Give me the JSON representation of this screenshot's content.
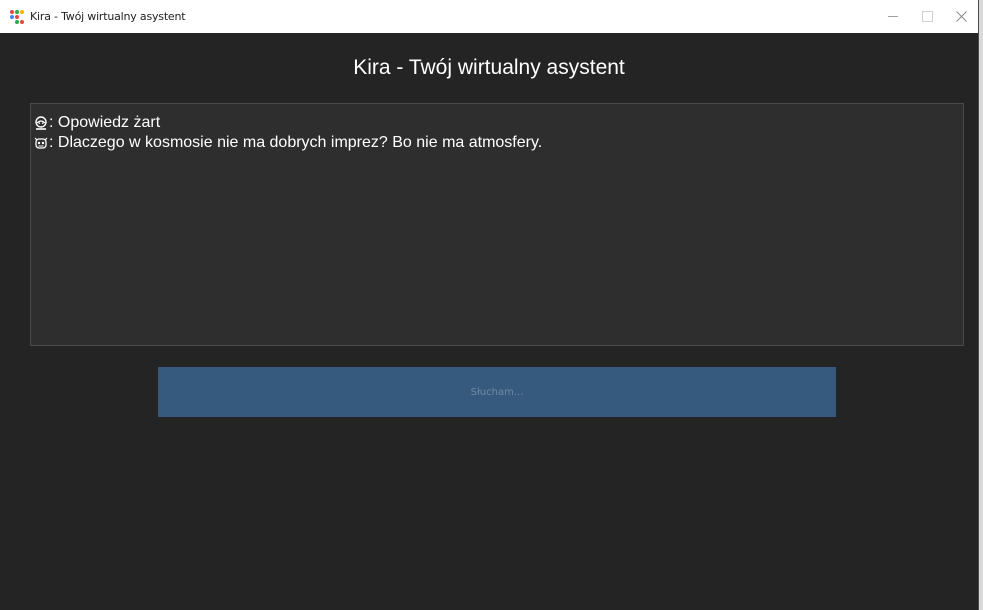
{
  "window": {
    "title": "Kira - Twój wirtualny asystent",
    "controls": [
      "minimize",
      "maximize",
      "close"
    ]
  },
  "app": {
    "header": "Kira - Twój wirtualny asystent"
  },
  "chat": {
    "messages": [
      {
        "sender_icon": "user-icon",
        "text": ": Opowiedz żart"
      },
      {
        "sender_icon": "robot-icon",
        "text": ": Dlaczego w kosmosie nie ma dobrych imprez? Bo nie ma atmosfery."
      }
    ]
  },
  "listen_button": {
    "label": "Słucham..."
  },
  "colors": {
    "window_bg": "#242424",
    "chat_bg": "#2e2e2e",
    "button_bg": "#365a7e",
    "button_text": "#6f8aa6",
    "text": "#ffffff"
  }
}
